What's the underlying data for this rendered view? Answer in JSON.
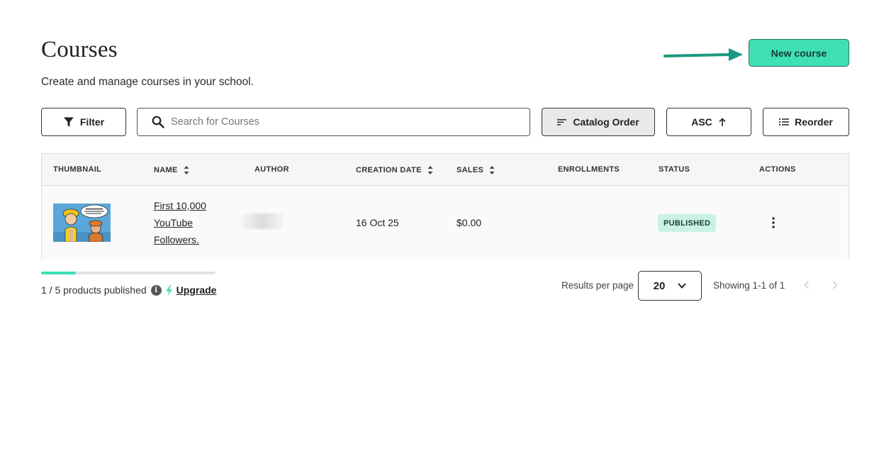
{
  "header": {
    "title": "Courses",
    "subtitle": "Create and manage courses in your school.",
    "new_course_label": "New course"
  },
  "toolbar": {
    "filter_label": "Filter",
    "search_placeholder": "Search for Courses",
    "search_value": "",
    "catalog_order_label": "Catalog Order",
    "asc_label": "ASC",
    "reorder_label": "Reorder"
  },
  "table": {
    "columns": [
      "THUMBNAIL",
      "NAME",
      "AUTHOR",
      "CREATION DATE",
      "SALES",
      "ENROLLMENTS",
      "STATUS",
      "ACTIONS"
    ],
    "rows": [
      {
        "name": "First 10,000 YouTube Followers.",
        "author": "",
        "creation_date": "16 Oct 25",
        "sales": "$0.00",
        "enrollments": "",
        "status": "PUBLISHED"
      }
    ]
  },
  "footer": {
    "published_progress": 0.2,
    "published_text": "1 / 5 products published",
    "upgrade_label": "Upgrade",
    "results_per_page_label": "Results per page",
    "results_per_page_value": "20",
    "showing_text": "Showing 1-1 of 1"
  },
  "colors": {
    "accent": "#3fe0b5",
    "annotation_arrow": "#1a9a80",
    "status_bg": "#c8f3e4"
  }
}
